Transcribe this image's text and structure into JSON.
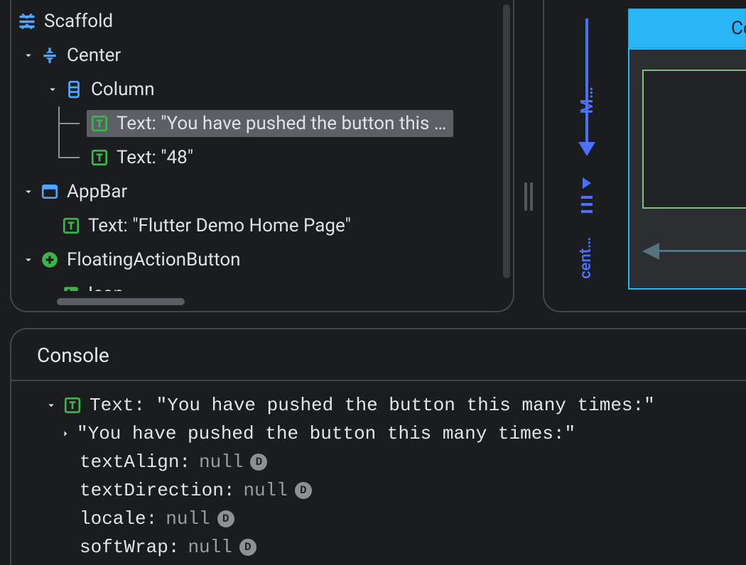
{
  "tree": {
    "scaffold": "Scaffold",
    "center": "Center",
    "column": "Column",
    "text1": "Text: \"You have pushed the button this …",
    "text2": "Text: \"48\"",
    "appbar": "AppBar",
    "appbar_text": "Text: \"Flutter Demo Home Page\"",
    "fab": "FloatingActionButton",
    "icon": "Icon"
  },
  "layout": {
    "column_label": "Colu",
    "axis_m": "M…",
    "axis_cent": "cent…"
  },
  "console": {
    "title": "Console",
    "header": "Text: \"You have pushed the button this many times:\"",
    "string_value": "\"You have pushed the button this many times:\"",
    "props": [
      {
        "name": "textAlign:",
        "value": "null"
      },
      {
        "name": "textDirection:",
        "value": "null"
      },
      {
        "name": "locale:",
        "value": "null"
      },
      {
        "name": "softWrap:",
        "value": "null"
      }
    ],
    "badge": "D"
  }
}
